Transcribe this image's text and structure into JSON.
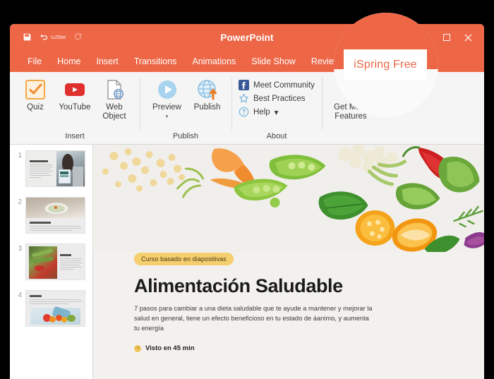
{
  "window": {
    "title": "PowerPoint",
    "quick_access": [
      {
        "name": "save-icon",
        "glyph": "⬚"
      },
      {
        "name": "undo-icon",
        "glyph": "↶"
      },
      {
        "name": "redo-icon",
        "glyph": "↷"
      }
    ],
    "controls": {
      "minimize": "—",
      "maximize": "□",
      "close": "✕"
    },
    "accent_color": "#ED6646"
  },
  "ribbon_tabs": [
    {
      "label": "File",
      "active": false
    },
    {
      "label": "Home",
      "active": false
    },
    {
      "label": "Insert",
      "active": false
    },
    {
      "label": "Transitions",
      "active": false
    },
    {
      "label": "Animations",
      "active": false
    },
    {
      "label": "Slide Show",
      "active": false
    },
    {
      "label": "Review",
      "active": false
    },
    {
      "label": "iSpring Free",
      "active": true
    }
  ],
  "ribbon_groups": [
    {
      "name": "Insert",
      "buttons": [
        {
          "label": "Quiz",
          "icon": "quiz-checkmark-icon"
        },
        {
          "label": "YouTube",
          "icon": "youtube-icon"
        },
        {
          "label": "Web Object",
          "icon": "web-object-icon"
        }
      ]
    },
    {
      "name": "Publish",
      "buttons": [
        {
          "label": "Preview",
          "icon": "preview-play-icon",
          "has_dropdown": true
        },
        {
          "label": "Publish",
          "icon": "publish-globe-icon",
          "has_dropdown": false
        }
      ]
    },
    {
      "name": "About",
      "small_buttons": [
        {
          "label": "Meet Community",
          "icon": "facebook-icon"
        },
        {
          "label": "Best Practices",
          "icon": "star-icon"
        },
        {
          "label": "Help",
          "icon": "help-question-icon",
          "has_dropdown": true
        }
      ]
    },
    {
      "name": "",
      "buttons": [
        {
          "label": "Get More Features",
          "icon": "plus-circle-icon"
        }
      ]
    }
  ],
  "slide_panel": {
    "slides": [
      {
        "number": "1",
        "title": "С чего начать",
        "layout": "text-left-image-right"
      },
      {
        "number": "2",
        "title": "Системный подход",
        "layout": "image-top-text-bottom"
      },
      {
        "number": "3",
        "title": "Овощи",
        "layout": "image-left-text-right"
      },
      {
        "number": "4",
        "title": "Фрукты",
        "layout": "text-top-image-bottom"
      }
    ]
  },
  "slide": {
    "badge": "Curso basado en diapositivas",
    "title": "Alimentación Saludable",
    "description": "7 pasos para cambiar a una dieta saludable que te ayude a mantener y mejorar la salud en general, tiene un efecto beneficioso en tu estado de áanimo, y aumenta tu energía",
    "meta": "Visto en 45 min",
    "badge_color": "#F5CE6E",
    "background_color": "#F3F1EE"
  },
  "magnifier": {
    "label": "iSpring Free",
    "label_color": "#ED6646"
  }
}
